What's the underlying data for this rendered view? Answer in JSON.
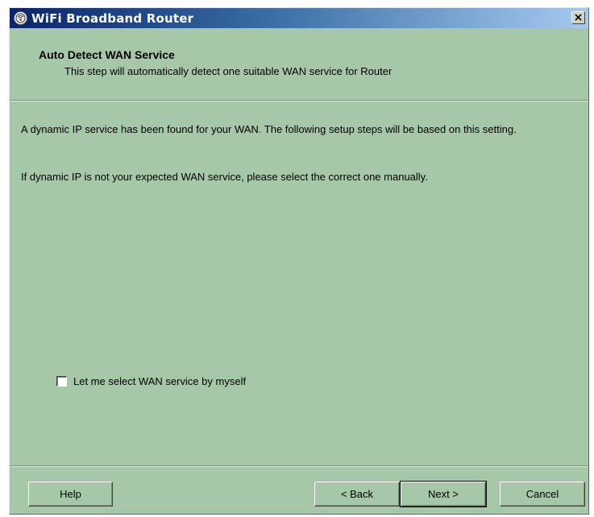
{
  "window": {
    "title": "WiFi Broadband Router",
    "icon": "router-globe-icon",
    "close_glyph": "✕"
  },
  "header": {
    "title": "Auto Detect WAN Service",
    "subtitle": "This step will automatically detect one suitable WAN service for Router"
  },
  "content": {
    "paragraph1": "A dynamic IP service has been found for your WAN. The following setup steps will be based on this setting.",
    "paragraph2": "If dynamic IP is not your expected WAN service, please select the correct one manually."
  },
  "options": {
    "manual_select_label": "Let me select WAN service by myself",
    "manual_select_checked": false
  },
  "buttons": {
    "help": "Help",
    "back": "< Back",
    "next": "Next >",
    "cancel": "Cancel"
  },
  "colors": {
    "background": "#a6c8a8",
    "titlebar_start": "#0a246a",
    "titlebar_end": "#a6caf0"
  }
}
